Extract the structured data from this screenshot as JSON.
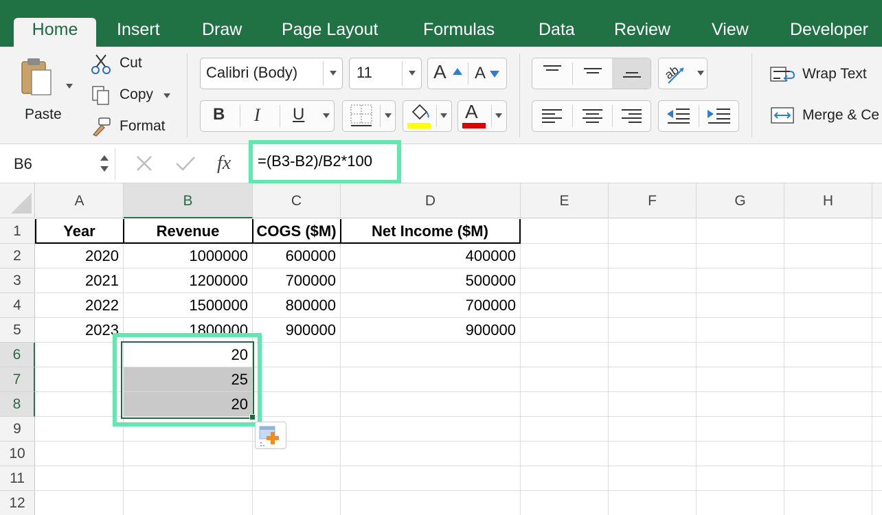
{
  "tabs": [
    "Home",
    "Insert",
    "Draw",
    "Page Layout",
    "Formulas",
    "Data",
    "Review",
    "View",
    "Developer"
  ],
  "clipboard": {
    "paste": "Paste",
    "cut": "Cut",
    "copy": "Copy",
    "format": "Format"
  },
  "font": {
    "name": "Calibri (Body)",
    "size": "11",
    "bold": "B",
    "italic": "I",
    "underline": "U",
    "grow": "A",
    "shrink": "A",
    "highlight_color": "#ffff00",
    "font_color_bar": "#e00000",
    "font_color_letter": "A"
  },
  "alignment": {
    "wrap_text": "Wrap Text",
    "merge": "Merge & Ce"
  },
  "formula_bar": {
    "name_box": "B6",
    "fx": "fx",
    "formula": "=(B3-B2)/B2*100"
  },
  "grid": {
    "columns": [
      "A",
      "B",
      "C",
      "D",
      "E",
      "F",
      "G",
      "H"
    ],
    "rows": [
      "1",
      "2",
      "3",
      "4",
      "5",
      "6",
      "7",
      "8",
      "9",
      "10",
      "11",
      "12"
    ],
    "headers": [
      "Year",
      "Revenue",
      "COGS ($M)",
      "Net Income ($M)"
    ],
    "data": [
      [
        "2020",
        "1000000",
        "600000",
        "400000"
      ],
      [
        "2021",
        "1200000",
        "700000",
        "500000"
      ],
      [
        "2022",
        "1500000",
        "800000",
        "700000"
      ],
      [
        "2023",
        "1800000",
        "900000",
        "900000"
      ]
    ],
    "computed": [
      "20",
      "25",
      "20"
    ]
  },
  "colors": {
    "ribbon_green": "#207245",
    "highlight": "#5fe8b0",
    "selection": "#1f6b41"
  }
}
